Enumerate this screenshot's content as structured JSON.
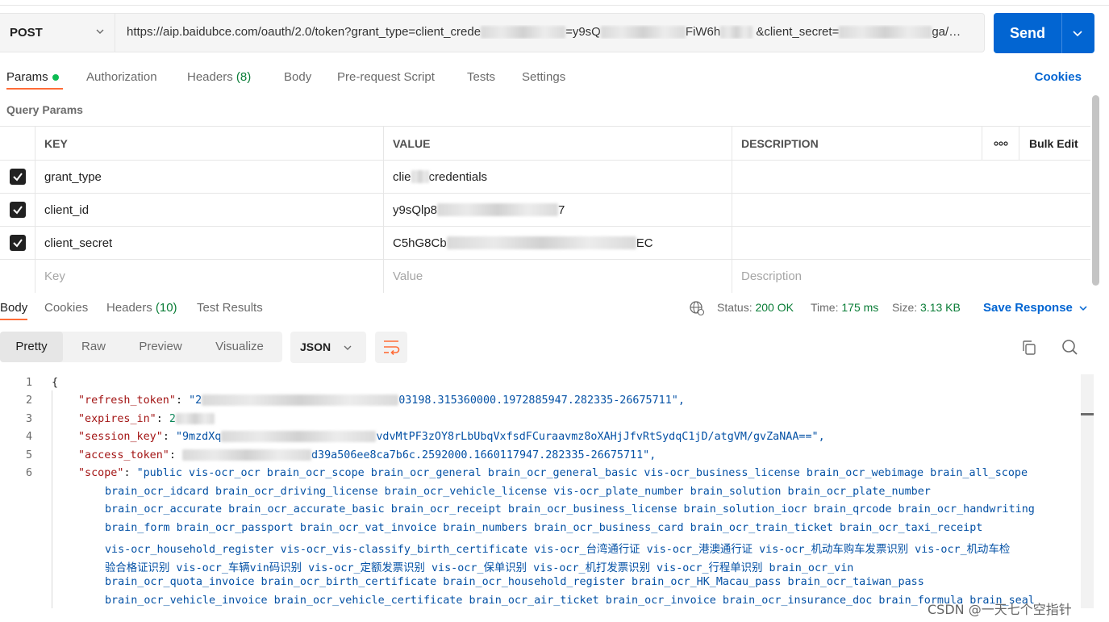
{
  "request": {
    "method": "POST",
    "url_parts": [
      "https://aip.baidubce.com/oauth/2.0/token?grant_type=client_crede",
      "=y9sQ",
      "FiW6h",
      "&client_secret=",
      "ga/…"
    ],
    "send_label": "Send"
  },
  "request_tabs": [
    {
      "label": "Params",
      "count": ""
    },
    {
      "label": "Authorization",
      "count": ""
    },
    {
      "label": "Headers",
      "count": "(8)"
    },
    {
      "label": "Body",
      "count": ""
    },
    {
      "label": "Pre-request Script",
      "count": ""
    },
    {
      "label": "Tests",
      "count": ""
    },
    {
      "label": "Settings",
      "count": ""
    }
  ],
  "cookies_label": "Cookies",
  "query_params_title": "Query Params",
  "params_table": {
    "headers": {
      "key": "KEY",
      "value": "VALUE",
      "description": "DESCRIPTION",
      "more": "ooo",
      "bulk_edit": "Bulk Edit"
    },
    "rows": [
      {
        "checked": true,
        "key": "grant_type",
        "value_prefix": "clie",
        "value_suffix": "credentials"
      },
      {
        "checked": true,
        "key": "client_id",
        "value_prefix": "y9sQlp8",
        "value_suffix": "7"
      },
      {
        "checked": true,
        "key": "client_secret",
        "value_prefix": "C5hG8Cb",
        "value_suffix": "EC"
      }
    ],
    "placeholders": {
      "key": "Key",
      "value": "Value",
      "description": "Description"
    }
  },
  "response_tabs": [
    {
      "label": "Body",
      "count": ""
    },
    {
      "label": "Cookies",
      "count": ""
    },
    {
      "label": "Headers",
      "count": "(10)"
    },
    {
      "label": "Test Results",
      "count": ""
    }
  ],
  "response_status": {
    "status_label": "Status:",
    "status_value": "200 OK",
    "time_label": "Time:",
    "time_value": "175 ms",
    "size_label": "Size:",
    "size_value": "3.13 KB",
    "save_response": "Save Response"
  },
  "view_modes": [
    "Pretty",
    "Raw",
    "Preview",
    "Visualize"
  ],
  "format": "JSON",
  "code": {
    "line_numbers": [
      "1",
      "2",
      "3",
      "4",
      "5",
      "6"
    ],
    "open_brace": "{",
    "refresh_token_key": "\"refresh_token\"",
    "refresh_token_start": "\"2",
    "refresh_token_end": "03198.315360000.1972885947.282335-26675711\",",
    "expires_in_key": "\"expires_in\"",
    "expires_in_start": "2",
    "session_key_key": "\"session_key\"",
    "session_key_start": "\"9mzdXq",
    "session_key_end": "vdvMtPF3zOY8rLbUbqVxfsdFCuraavmz8oXAHjJfvRtSydqC1jD/atgVM/gvZaNAA==\",",
    "access_token_key": "\"access_token\"",
    "access_token_end": "d39a506ee8ca7b6c.2592000.1660117947.282335-26675711\",",
    "scope_key": "\"scope\"",
    "scope_lines": [
      "\"public vis-ocr_ocr brain_ocr_scope brain_ocr_general brain_ocr_general_basic vis-ocr_business_license brain_ocr_webimage brain_all_scope",
      "brain_ocr_idcard brain_ocr_driving_license brain_ocr_vehicle_license vis-ocr_plate_number brain_solution brain_ocr_plate_number",
      "brain_ocr_accurate brain_ocr_accurate_basic brain_ocr_receipt brain_ocr_business_license brain_solution_iocr brain_qrcode brain_ocr_handwriting",
      "brain_form brain_ocr_passport brain_ocr_vat_invoice brain_numbers brain_ocr_business_card brain_ocr_train_ticket brain_ocr_taxi_receipt",
      "vis-ocr_household_register vis-ocr_vis-classify_birth_certificate vis-ocr_台湾通行证 vis-ocr_港澳通行证 vis-ocr_机动车购车发票识别 vis-ocr_机动车检",
      "验合格证识别 vis-ocr_车辆vin码识别 vis-ocr_定额发票识别 vis-ocr_保单识别 vis-ocr_机打发票识别 vis-ocr_行程单识别 brain_ocr_vin",
      "brain_ocr_quota_invoice brain_ocr_birth_certificate brain_ocr_household_register brain_ocr_HK_Macau_pass brain_ocr_taiwan_pass",
      "brain_ocr_vehicle_invoice brain_ocr_vehicle_certificate brain_ocr_air_ticket brain_ocr_invoice brain_ocr_insurance_doc brain_formula brain_seal"
    ]
  },
  "watermark": "CSDN @一天七个空指针"
}
